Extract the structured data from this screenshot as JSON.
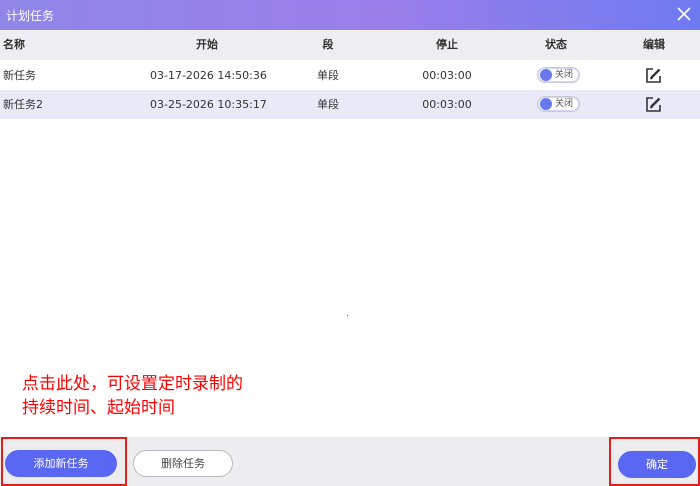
{
  "window": {
    "title": "计划任务",
    "close_icon": "close-icon"
  },
  "table": {
    "headers": {
      "name": "名称",
      "start": "开始",
      "segment": "段",
      "stop": "停止",
      "status": "状态",
      "edit": "编辑"
    },
    "rows": [
      {
        "name": "新任务",
        "start": "03-17-2026 14:50:36",
        "segment": "单段",
        "stop": "00:03:00",
        "status": "关闭",
        "edit_icon": "edit-icon"
      },
      {
        "name": "新任务2",
        "start": "03-25-2026 10:35:17",
        "segment": "单段",
        "stop": "00:03:00",
        "status": "关闭",
        "edit_icon": "edit-icon"
      }
    ]
  },
  "annotation": {
    "line1": "点击此处，可设置定时录制的",
    "line2": "持续时间、起始时间",
    "color": "#ff0000"
  },
  "footer": {
    "add_label": "添加新任务",
    "delete_label": "删除任务",
    "ok_label": "确定"
  },
  "colors": {
    "accent": "#5a67f2",
    "highlight_box": "#e0201a",
    "selected_row": "#e9eaf8"
  }
}
